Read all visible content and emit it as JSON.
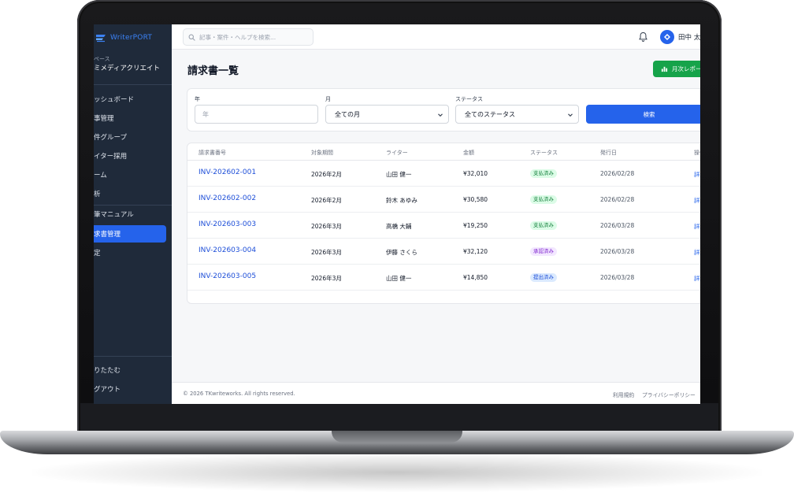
{
  "sidebar": {
    "brand": "WriterPORT",
    "workspace_label": "ペース",
    "workspace_name": "ミメディアクリエイト",
    "items": [
      {
        "label": "ッシュボード"
      },
      {
        "label": "事管理"
      },
      {
        "label": "件グループ"
      },
      {
        "label": "イター採用"
      },
      {
        "label": "ーム"
      },
      {
        "label": "析"
      },
      {
        "label": "筆マニュアル"
      },
      {
        "label": "求書管理"
      },
      {
        "label": "定"
      }
    ],
    "bottom_items": [
      {
        "label": "りたたむ"
      },
      {
        "label": "グアウト"
      }
    ]
  },
  "topbar": {
    "search_placeholder": "記事・案件・ヘルプを検索...",
    "user_name": "田中 太郎"
  },
  "page": {
    "title": "請求書一覧",
    "report_button": "月次レポート"
  },
  "filters": {
    "year_label": "年",
    "year_placeholder": "年",
    "month_label": "月",
    "month_value": "全ての月",
    "status_label": "ステータス",
    "status_value": "全てのステータス",
    "search_button": "検索"
  },
  "table": {
    "headers": [
      "請求書番号",
      "対象期間",
      "ライター",
      "金額",
      "ステータス",
      "発行日",
      "操作"
    ],
    "rows": [
      {
        "invoice": "INV-202602-001",
        "period": "2026年2月",
        "writer": "山田 健一",
        "amount": "¥32,010",
        "status": "支払済み",
        "status_kind": "paid",
        "issued": "2026/02/28",
        "action": "詳細"
      },
      {
        "invoice": "INV-202602-002",
        "period": "2026年2月",
        "writer": "鈴木 あゆみ",
        "amount": "¥30,580",
        "status": "支払済み",
        "status_kind": "paid",
        "issued": "2026/02/28",
        "action": "詳細"
      },
      {
        "invoice": "INV-202603-003",
        "period": "2026年3月",
        "writer": "高橋 大輔",
        "amount": "¥19,250",
        "status": "支払済み",
        "status_kind": "paid",
        "issued": "2026/03/28",
        "action": "詳細"
      },
      {
        "invoice": "INV-202603-004",
        "period": "2026年3月",
        "writer": "伊藤 さくら",
        "amount": "¥32,120",
        "status": "承認済み",
        "status_kind": "approved",
        "issued": "2026/03/28",
        "action": "詳細"
      },
      {
        "invoice": "INV-202603-005",
        "period": "2026年3月",
        "writer": "山田 健一",
        "amount": "¥14,850",
        "status": "提出済み",
        "status_kind": "submitted",
        "issued": "2026/03/28",
        "action": "詳細"
      }
    ]
  },
  "status_colors": {
    "paid": {
      "bg": "#dcfce7",
      "fg": "#15803d"
    },
    "approved": {
      "bg": "#f3e8ff",
      "fg": "#7e22ce"
    },
    "submitted": {
      "bg": "#dbeafe",
      "fg": "#1d4ed8"
    }
  },
  "footer": {
    "copyright": "© 2026 TKwriteworks. All rights reserved.",
    "links": [
      "利用規約",
      "プライバシーポリシー"
    ]
  },
  "colors": {
    "accent": "#2563eb",
    "sidebar_bg": "#1f2a3a",
    "report_button": "#16a34a"
  }
}
